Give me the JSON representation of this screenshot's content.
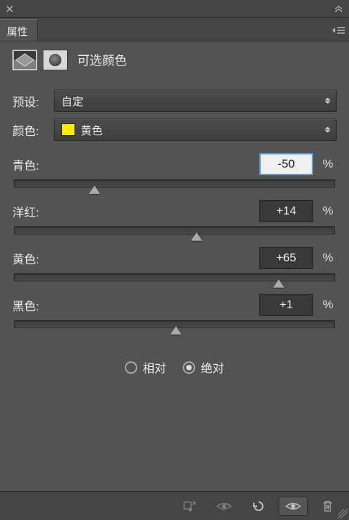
{
  "panel": {
    "title": "属性",
    "adjustment_name": "可选颜色"
  },
  "form": {
    "preset": {
      "label": "预设:",
      "value": "自定"
    },
    "color": {
      "label": "颜色:",
      "value": "黄色",
      "swatch": "#ffed00"
    }
  },
  "sliders": [
    {
      "label": "青色:",
      "value": "-50",
      "thumb_pct": 25,
      "focus": true
    },
    {
      "label": "洋红:",
      "value": "+14",
      "thumb_pct": 57,
      "focus": false
    },
    {
      "label": "黄色:",
      "value": "+65",
      "thumb_pct": 82.5,
      "focus": false
    },
    {
      "label": "黑色:",
      "value": "+1",
      "thumb_pct": 50.5,
      "focus": false
    }
  ],
  "method": {
    "relative": "相对",
    "absolute": "绝对",
    "selected": "absolute"
  },
  "footer_icons": [
    "clip-to-layer",
    "toggle-visibility",
    "reset",
    "view-previous",
    "delete"
  ],
  "pct_symbol": "%"
}
